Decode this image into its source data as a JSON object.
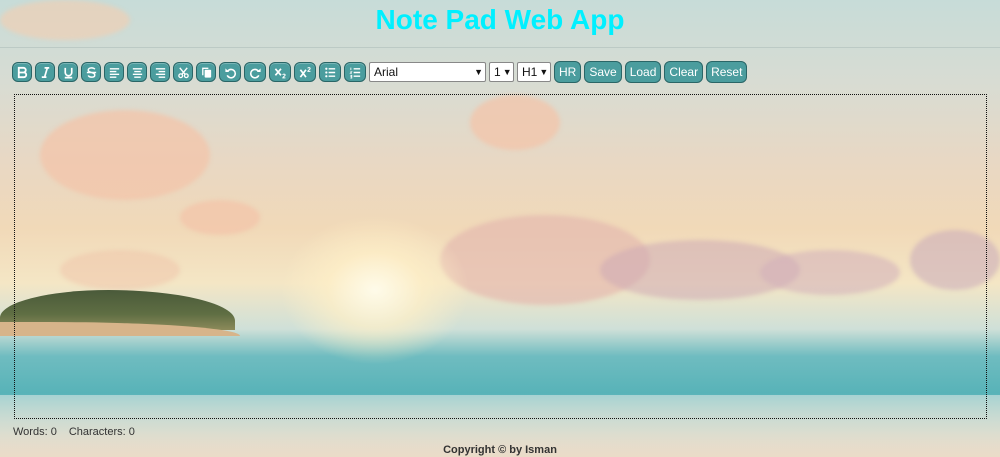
{
  "app": {
    "title": "Note Pad Web App"
  },
  "toolbar": {
    "font_family": "Arial",
    "font_size": "1",
    "heading": "H1",
    "hr_label": "HR",
    "save_label": "Save",
    "load_label": "Load",
    "clear_label": "Clear",
    "reset_label": "Reset"
  },
  "stats": {
    "words": "Words: 0",
    "characters": "Characters: 0"
  },
  "footer": {
    "text": "Copyright © by Isman"
  },
  "colors": {
    "title": "#00f0ff",
    "button_bg": "#4b9d9e",
    "button_border": "#2a6667"
  }
}
